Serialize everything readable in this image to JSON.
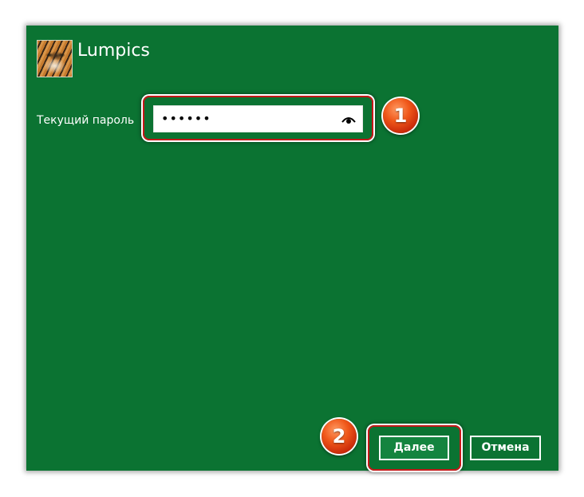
{
  "account": {
    "name": "Lumpics",
    "avatar": "tiger-avatar"
  },
  "password": {
    "label": "Текущий пароль",
    "value": "••••••",
    "reveal_icon": "eye-icon"
  },
  "buttons": {
    "next_label": "Далее",
    "cancel_label": "Отмена"
  },
  "annotations": {
    "step1": "1",
    "step2": "2"
  },
  "colors": {
    "dialog_background": "#0b7332",
    "highlight": "#c41818",
    "badge": "#f0581a"
  }
}
